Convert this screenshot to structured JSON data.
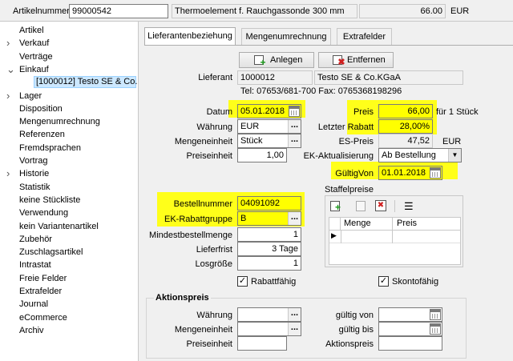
{
  "header": {
    "artikelnummer_label": "Artikelnummer",
    "artikelnummer_value": "99000542",
    "description": "Thermoelement f. Rauchgassonde 300 mm",
    "price": "66.00",
    "currency": "EUR"
  },
  "tree": {
    "items": [
      {
        "label": "Artikel",
        "arrow": ""
      },
      {
        "label": "Verkauf",
        "arrow": ">"
      },
      {
        "label": "Verträge",
        "arrow": ""
      },
      {
        "label": "Einkauf",
        "arrow": "v"
      },
      {
        "label": "[1000012] Testo SE & Co.",
        "arrow": ""
      },
      {
        "label": "Lager",
        "arrow": ">"
      },
      {
        "label": "Disposition",
        "arrow": ""
      },
      {
        "label": "Mengenumrechnung",
        "arrow": ""
      },
      {
        "label": "Referenzen",
        "arrow": ""
      },
      {
        "label": "Fremdsprachen",
        "arrow": ""
      },
      {
        "label": "Vortrag",
        "arrow": ""
      },
      {
        "label": "Historie",
        "arrow": ">"
      },
      {
        "label": "Statistik",
        "arrow": ""
      },
      {
        "label": "keine Stückliste",
        "arrow": ""
      },
      {
        "label": "Verwendung",
        "arrow": ""
      },
      {
        "label": "kein Variantenartikel",
        "arrow": ""
      },
      {
        "label": "Zubehör",
        "arrow": ""
      },
      {
        "label": "Zuschlagsartikel",
        "arrow": ""
      },
      {
        "label": "Intrastat",
        "arrow": ""
      },
      {
        "label": "Freie Felder",
        "arrow": ""
      },
      {
        "label": "Extrafelder",
        "arrow": ""
      },
      {
        "label": "Journal",
        "arrow": ""
      },
      {
        "label": "eCommerce",
        "arrow": ""
      },
      {
        "label": "Archiv",
        "arrow": ""
      }
    ]
  },
  "tabs": [
    "Lieferantenbeziehung",
    "Mengenumrechnung",
    "Extrafelder"
  ],
  "toolbar": {
    "add_label": "Anlegen",
    "delete_label": "Entfernen"
  },
  "lieferant": {
    "label": "Lieferant",
    "number": "1000012",
    "name": "Testo SE & Co.KGaA",
    "contact": "Tel: 07653/681-700   Fax: 0765368198296"
  },
  "form": {
    "datum_label": "Datum",
    "datum_value": "05.01.2018",
    "waehrung_label": "Währung",
    "waehrung_value": "EUR",
    "mengeneinheit_label": "Mengeneinheit",
    "mengeneinheit_value": "Stück",
    "preiseinheit_label": "Preiseinheit",
    "preiseinheit_value": "1,00",
    "preis_label": "Preis",
    "preis_value": "66,00",
    "preis_suffix": "für 1 Stück",
    "rabatt_label": "Letzter Rabatt",
    "rabatt_value": "28,00%",
    "espreis_label": "ES-Preis",
    "espreis_value": "47,52",
    "espreis_currency": "EUR",
    "ekakt_label": "EK-Aktualisierung",
    "ekakt_value": "Ab Bestellung",
    "gueltig_label": "GültigVon",
    "gueltig_value": "01.01.2018",
    "bestellnummer_label": "Bestellnummer",
    "bestellnummer_value": "04091092",
    "rabattgruppe_label": "EK-Rabattgruppe",
    "rabattgruppe_value": "B",
    "mindest_label": "Mindestbestellmenge",
    "mindest_value": "1",
    "lieferfrist_label": "Lieferfrist",
    "lieferfrist_value": "3 Tage",
    "losgroesse_label": "Losgröße",
    "losgroesse_value": "1",
    "rabattfaehig_label": "Rabattfähig",
    "skontofaehig_label": "Skontofähig"
  },
  "staffel": {
    "title": "Staffelpreise",
    "columns": [
      "Menge",
      "Preis"
    ]
  },
  "aktion": {
    "title": "Aktionspreis",
    "waehrung_label": "Währung",
    "mengeneinheit_label": "Mengeneinheit",
    "preiseinheit_label": "Preiseinheit",
    "gueltig_von_label": "gültig von",
    "gueltig_bis_label": "gültig bis",
    "aktionspreis_label": "Aktionspreis"
  }
}
